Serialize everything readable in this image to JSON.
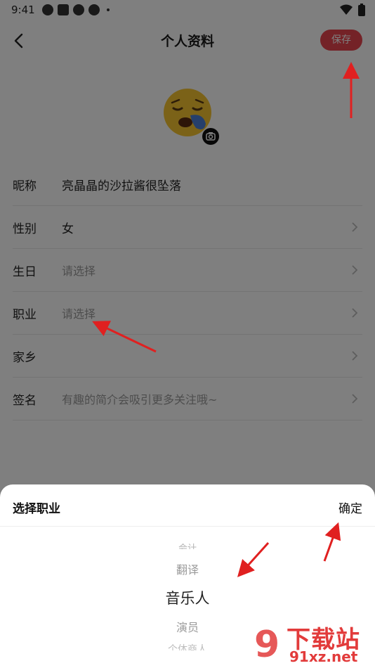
{
  "status_bar": {
    "time": "9:41"
  },
  "header": {
    "title": "个人资料",
    "save_label": "保存"
  },
  "profile_rows": [
    {
      "label": "昵称",
      "value": "亮晶晶的沙拉酱很坠落"
    },
    {
      "label": "性别",
      "value": "女"
    },
    {
      "label": "生日",
      "placeholder": "请选择"
    },
    {
      "label": "职业",
      "placeholder": "请选择"
    },
    {
      "label": "家乡",
      "value": ""
    },
    {
      "label": "签名",
      "placeholder": "有趣的简介会吸引更多关注哦~"
    }
  ],
  "sheet": {
    "title": "选择职业",
    "confirm_label": "确定",
    "picker": {
      "above_partial": "会计",
      "above": "翻译",
      "selected": "音乐人",
      "below": "演员",
      "below_partial": "个体商人"
    }
  },
  "watermark": {
    "brand": "下载站",
    "domain": "91xz.net"
  },
  "colors": {
    "accent": "#e8454e",
    "annotation_arrow": "#e02020"
  }
}
